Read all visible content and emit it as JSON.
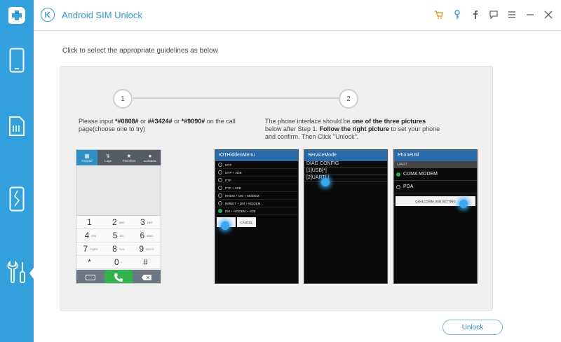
{
  "app": {
    "title": "Android SIM Unlock"
  },
  "header_icons": [
    "cart-icon",
    "key-icon",
    "facebook-icon",
    "feedback-icon",
    "menu-icon",
    "minimize-icon",
    "close-icon"
  ],
  "sidebar": {
    "items": [
      "phone-icon",
      "sim-card-icon",
      "broken-phone-icon",
      "tools-icon"
    ],
    "active": "tools-icon"
  },
  "main": {
    "instruction": "Click to select the appropriate guidelines as below",
    "step1": {
      "number": "1"
    },
    "step2": {
      "number": "2"
    }
  },
  "dialer": {
    "tabs": [
      "Keypad",
      "Logs",
      "Favorites",
      "Contacts"
    ],
    "keys": [
      {
        "n": "1",
        "l": ""
      },
      {
        "n": "2",
        "l": "ABC"
      },
      {
        "n": "3",
        "l": "DEF"
      },
      {
        "n": "4",
        "l": "GHI"
      },
      {
        "n": "5",
        "l": "JKL"
      },
      {
        "n": "6",
        "l": "MNO"
      },
      {
        "n": "7",
        "l": "PQRS"
      },
      {
        "n": "8",
        "l": "TUV"
      },
      {
        "n": "9",
        "l": "WXYZ"
      },
      {
        "n": "*",
        "l": ""
      },
      {
        "n": "0",
        "l": "+"
      },
      {
        "n": "#",
        "l": ""
      }
    ]
  },
  "screens": {
    "hidden_menu": {
      "title": "IOTHiddenMenu",
      "items": [
        "MTP",
        "MTP + ADB",
        "PTP",
        "PTP + ADB",
        "RNDIS + DM + MODEM",
        "RMNET + DM + MODEM",
        "DM + MODEM + ADB"
      ],
      "selected_index": 6,
      "ok": "OK",
      "cancel": "CANCEL"
    },
    "service_mode": {
      "title": "ServiceMode",
      "lines": [
        "DIAG CONFIG",
        "[1]USB[*]",
        "[2]UART[ ]"
      ]
    },
    "phone_util": {
      "title": "PhoneUtil",
      "section": "UART",
      "options": [
        "CDMA MODEM",
        "PDA"
      ],
      "selected_index": 0,
      "button": "QUALCOMM USB SETTING"
    }
  },
  "unlock_button": {
    "label": "Unlock"
  },
  "colors": {
    "accent": "#32a0dd",
    "call_green": "#2fb34a",
    "cart": "#f29c1f"
  }
}
